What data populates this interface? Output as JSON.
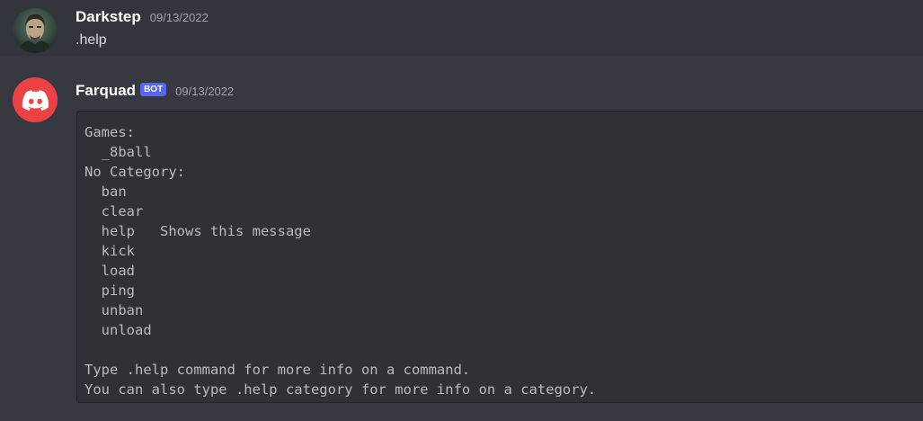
{
  "messages": [
    {
      "author": "Darkstep",
      "timestamp": "09/13/2022",
      "avatar_icon": "user-portrait-avatar",
      "content": ".help"
    },
    {
      "author": "Farquad",
      "bot_tag": "BOT",
      "timestamp": "09/13/2022",
      "avatar_icon": "discord-logo-icon",
      "avatar_color": "#ed4245",
      "code_block": "Games:\n  _8ball\nNo Category:\n  ban\n  clear\n  help   Shows this message\n  kick\n  load\n  ping\n  unban\n  unload\n\nType .help command for more info on a command.\nYou can also type .help category for more info on a category."
    }
  ],
  "colors": {
    "background": "#36393f",
    "highlighted_message": "#32353b",
    "code_block_bg": "#2f3136",
    "bot_tag": "#5865f2",
    "username": "#ffffff",
    "timestamp": "#a3a6aa"
  }
}
